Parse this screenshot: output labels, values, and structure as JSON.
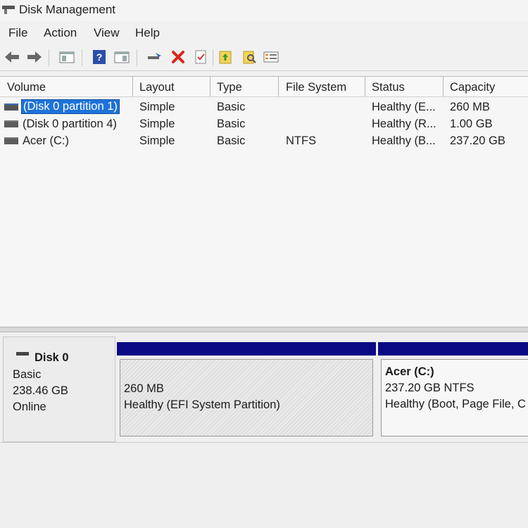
{
  "window": {
    "title": "Disk Management"
  },
  "menu": {
    "items": [
      "File",
      "Action",
      "View",
      "Help"
    ]
  },
  "toolbar": {
    "icons": [
      "back-arrow-icon",
      "forward-arrow-icon",
      "console-tree-icon",
      "help-icon",
      "action-pane-icon",
      "connect-icon",
      "delete-icon",
      "properties-icon",
      "import-icon",
      "search-icon",
      "list-view-icon"
    ]
  },
  "volume_list": {
    "columns": [
      "Volume",
      "Layout",
      "Type",
      "File System",
      "Status",
      "Capacity"
    ],
    "rows": [
      {
        "volume": "(Disk 0 partition 1)",
        "layout": "Simple",
        "type": "Basic",
        "file_system": "",
        "status": "Healthy (E...",
        "capacity": "260 MB",
        "selected": true
      },
      {
        "volume": "(Disk 0 partition 4)",
        "layout": "Simple",
        "type": "Basic",
        "file_system": "",
        "status": "Healthy (R...",
        "capacity": "1.00 GB",
        "selected": false
      },
      {
        "volume": "Acer (C:)",
        "layout": "Simple",
        "type": "Basic",
        "file_system": "NTFS",
        "status": "Healthy (B...",
        "capacity": "237.20 GB",
        "selected": false
      }
    ]
  },
  "disk_view": {
    "disk": {
      "name": "Disk 0",
      "type": "Basic",
      "size": "238.46 GB",
      "state": "Online"
    },
    "partitions": [
      {
        "size": "260 MB",
        "status": "Healthy (EFI System Partition)"
      },
      {
        "label": "Acer  (C:)",
        "size": "237.20 GB NTFS",
        "status": "Healthy (Boot, Page File, C"
      }
    ]
  },
  "colors": {
    "partition_bar": "#0b0a85",
    "selection": "#1e73d8",
    "accent_icon": "#3b6db5",
    "delete_icon": "#d9261c"
  }
}
